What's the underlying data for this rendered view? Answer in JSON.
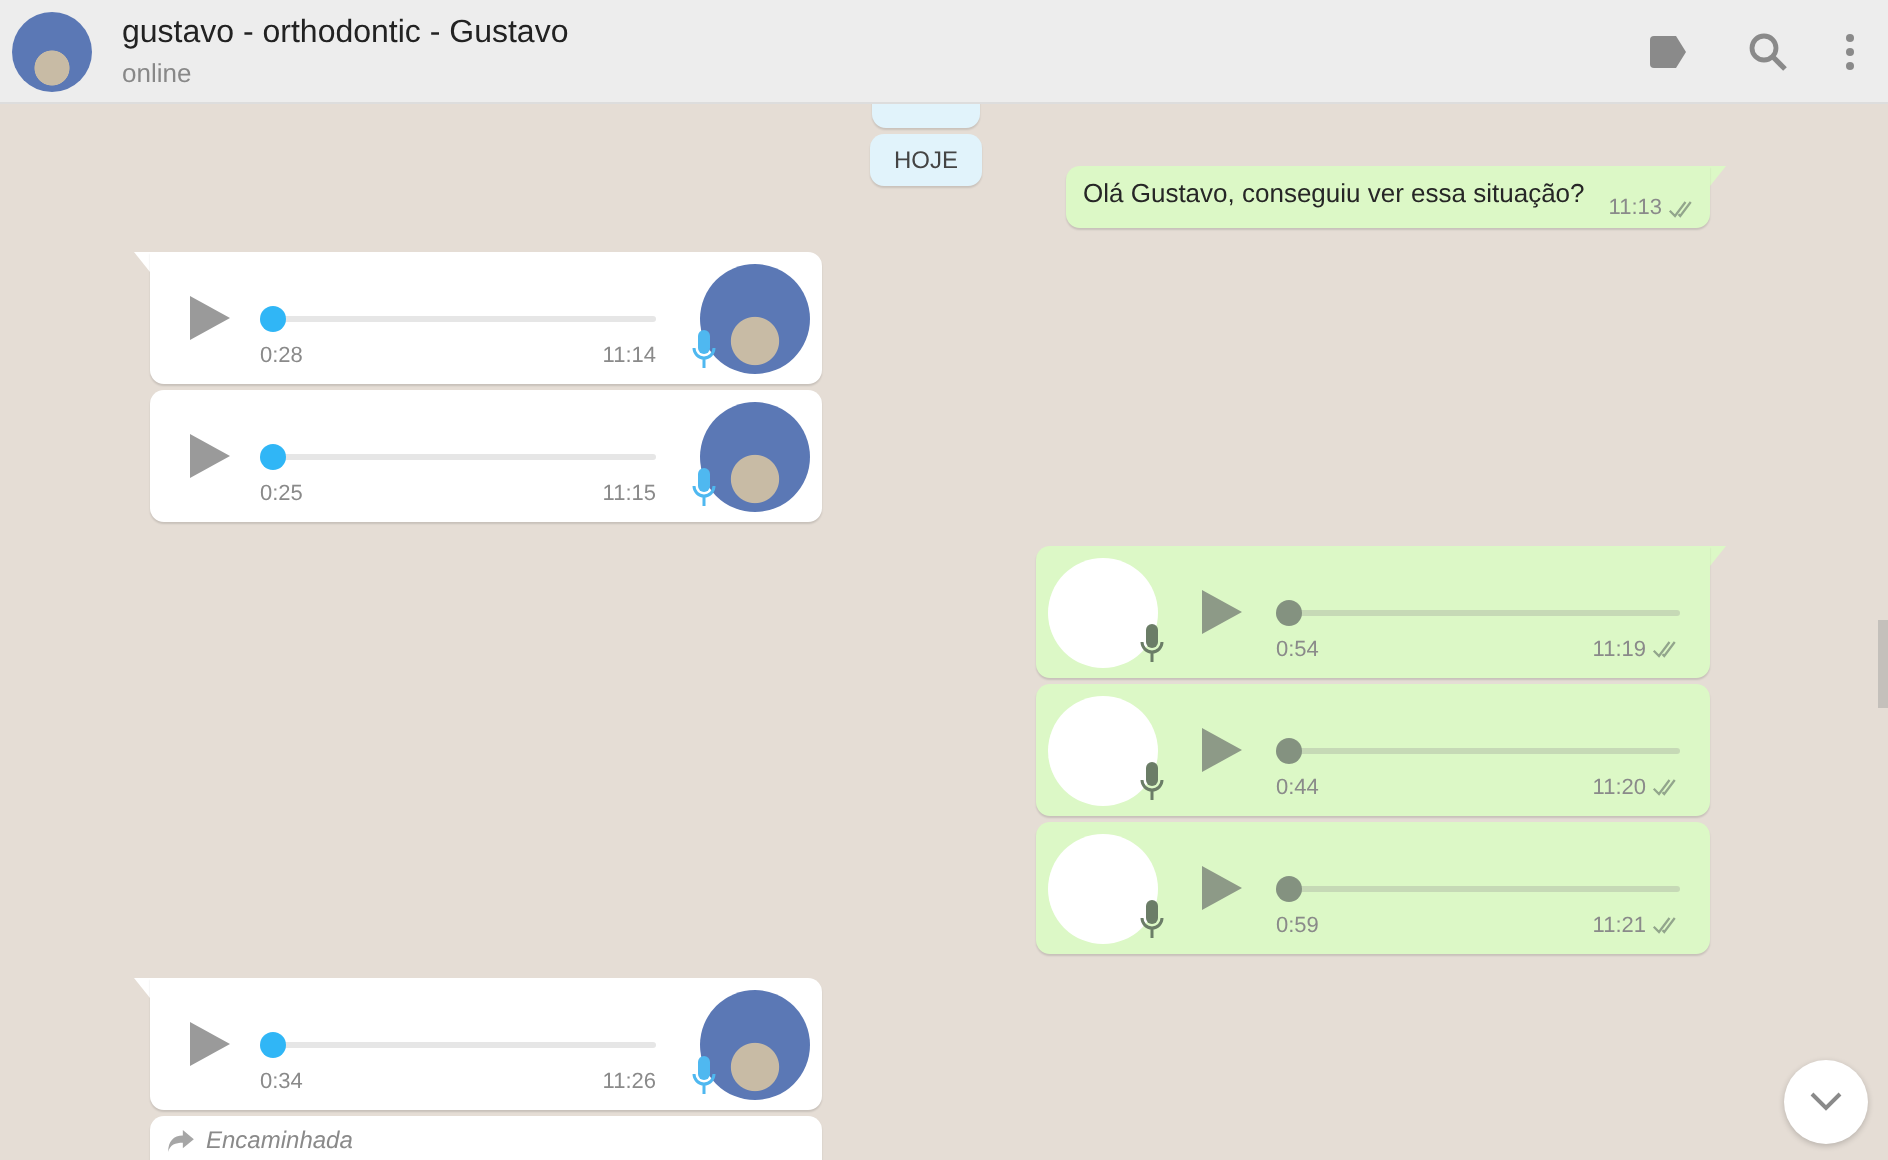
{
  "header": {
    "title": "gustavo - orthodontic - Gustavo",
    "status": "online"
  },
  "messages": [
    {
      "kind": "date"
    },
    {
      "kind": "date",
      "label": "HOJE"
    },
    {
      "kind": "text",
      "outgoing": true,
      "text": "Olá Gustavo, conseguiu ver essa situação?",
      "time": "11:13",
      "read": true,
      "tail": true
    },
    {
      "kind": "audio",
      "outgoing": false,
      "duration": "0:28",
      "time": "11:14",
      "level": 0,
      "tail": true
    },
    {
      "kind": "audio",
      "outgoing": false,
      "duration": "0:25",
      "time": "11:15",
      "level": 0,
      "tail": false
    },
    {
      "kind": "audio",
      "outgoing": true,
      "duration": "0:54",
      "time": "11:19",
      "level": 0,
      "read": true,
      "tail": true
    },
    {
      "kind": "audio",
      "outgoing": true,
      "duration": "0:44",
      "time": "11:20",
      "level": 0,
      "read": true,
      "tail": false
    },
    {
      "kind": "audio",
      "outgoing": true,
      "duration": "0:59",
      "time": "11:21",
      "level": 0,
      "read": true,
      "tail": false
    },
    {
      "kind": "audio",
      "outgoing": false,
      "duration": "0:34",
      "time": "11:26",
      "level": 0,
      "tail": true
    },
    {
      "kind": "forwarded",
      "outgoing": false,
      "label": "Encaminhada",
      "tail": false
    }
  ]
}
